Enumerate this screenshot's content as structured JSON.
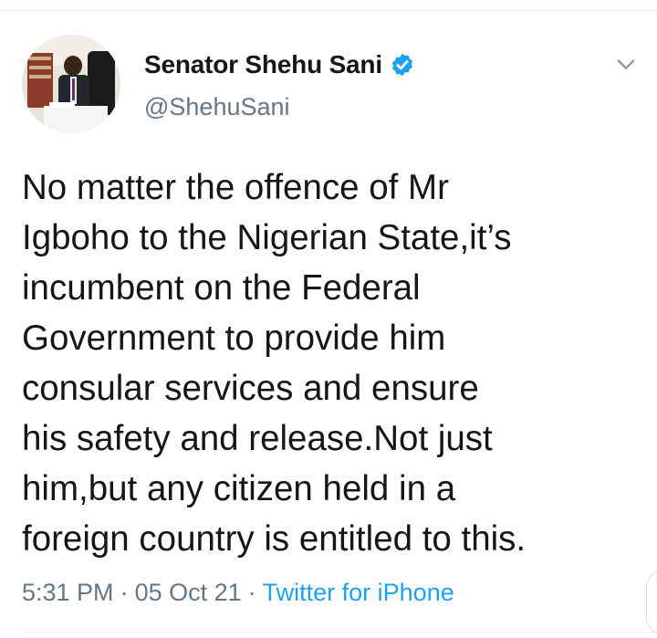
{
  "author": {
    "display_name": "Senator Shehu Sani",
    "handle": "@ShehuSani",
    "verified": true
  },
  "tweet": {
    "text_lines": [
      "No matter the offence of Mr",
      "Igboho to the Nigerian State,it’s",
      "incumbent on the Federal",
      "Government to provide him",
      "consular services and ensure",
      "his safety and release.Not just",
      "him,but any citizen held in a",
      "foreign country is entitled to this."
    ],
    "time": "5:31 PM",
    "separator": "·",
    "date": "05 Oct 21",
    "source": "Twitter for iPhone"
  },
  "icons": {
    "verified": "verified-badge-icon",
    "menu": "chevron-down-icon"
  },
  "colors": {
    "text": "#14171a",
    "secondary": "#657786",
    "link": "#1da1f2",
    "divider": "#e6ecf0"
  }
}
